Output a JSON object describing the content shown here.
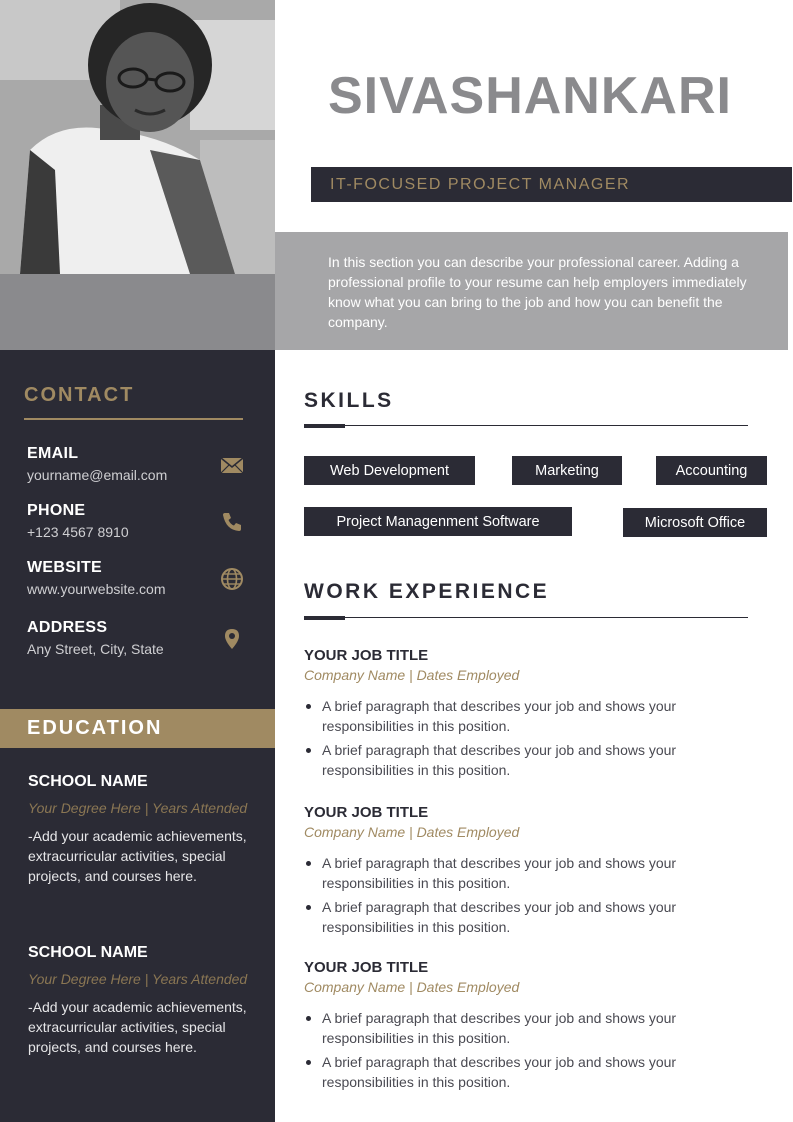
{
  "profile": {
    "name": "SIVASHANKARI",
    "title": "IT-FOCUSED PROJECT MANAGER",
    "summary": "In this section you can describe your professional career. Adding a professional profile to your resume can help employers immediately know what you can bring to the job and how you can benefit the company."
  },
  "contact": {
    "heading": "CONTACT",
    "items": [
      {
        "label": "EMAIL",
        "value": "yourname@email.com",
        "icon": "envelope-icon"
      },
      {
        "label": "PHONE",
        "value": "+123 4567 8910",
        "icon": "phone-icon"
      },
      {
        "label": "WEBSITE",
        "value": "www.yourwebsite.com",
        "icon": "globe-icon"
      },
      {
        "label": "ADDRESS",
        "value": "Any Street, City, State",
        "icon": "location-pin-icon"
      }
    ]
  },
  "education": {
    "heading": "EDUCATION",
    "schools": [
      {
        "name": "SCHOOL NAME",
        "degree": "Your Degree Here | Years Attended",
        "description": "-Add your academic achievements, extracurricular activities, special projects, and courses here."
      },
      {
        "name": "SCHOOL NAME",
        "degree": "Your Degree Here | Years Attended",
        "description": "-Add your academic achievements, extracurricular activities, special projects, and courses here."
      }
    ]
  },
  "skills": {
    "heading": "SKILLS",
    "items": [
      "Web Development",
      "Marketing",
      "Accounting",
      "Project Managenment Software",
      "Microsoft Office"
    ]
  },
  "experience": {
    "heading": "WORK EXPERIENCE",
    "jobs": [
      {
        "title": "YOUR JOB TITLE",
        "company": "Company Name  |  Dates Employed",
        "bullets": [
          "A brief paragraph that describes your job and shows your responsibilities in this position.",
          "A brief paragraph that describes your job and shows your responsibilities in this position."
        ]
      },
      {
        "title": "YOUR JOB TITLE",
        "company": "Company Name  |  Dates Employed",
        "bullets": [
          "A brief paragraph that describes your job and shows your responsibilities in this position.",
          "A brief paragraph that describes your job and shows your responsibilities in this position."
        ]
      },
      {
        "title": "YOUR JOB TITLE",
        "company": "Company Name  |  Dates Employed",
        "bullets": [
          "A brief paragraph that describes your job and shows your responsibilities in this position.",
          "A brief paragraph that describes your job and shows your responsibilities in this position."
        ]
      }
    ]
  },
  "colors": {
    "sidebar": "#2b2b35",
    "accent_gold": "#a08a62",
    "name_gray": "#8a8a8d",
    "summary_gray": "#a6a6a8"
  }
}
